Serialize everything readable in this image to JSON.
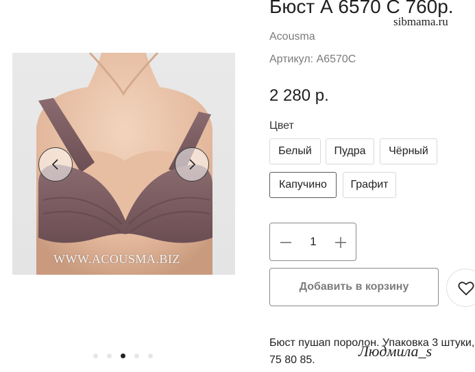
{
  "product": {
    "title": "Бюст А 6570 С 760р.",
    "brand": "Acousma",
    "sku": "Артикул: А6570С",
    "price": "2 280 р.",
    "description": "Бюст пушап поролон. Упаковка 3 штуки, 75 80 85."
  },
  "gallery": {
    "image_watermark": "WWW.ACOUSMA.BIZ",
    "prev_icon": "chevron-left-icon",
    "next_icon": "chevron-right-icon",
    "slide_count": 5,
    "active_slide": 3
  },
  "color": {
    "label": "Цвет",
    "options": [
      "Белый",
      "Пудра",
      "Чёрный",
      "Капучино",
      "Графит"
    ],
    "selected": "Капучино"
  },
  "quantity": {
    "value": "1",
    "minus_icon": "minus-icon",
    "plus_icon": "plus-icon"
  },
  "cart": {
    "add_label": "Добавить в корзину",
    "wishlist_icon": "heart-icon"
  },
  "watermarks": {
    "top": "sibmama.ru",
    "bottom": "Людмила_s"
  },
  "colors": {
    "text": "#1f1f1f",
    "muted": "#7a7a7a",
    "border": "#d8d8d8",
    "fabric": "#7a5c60"
  }
}
